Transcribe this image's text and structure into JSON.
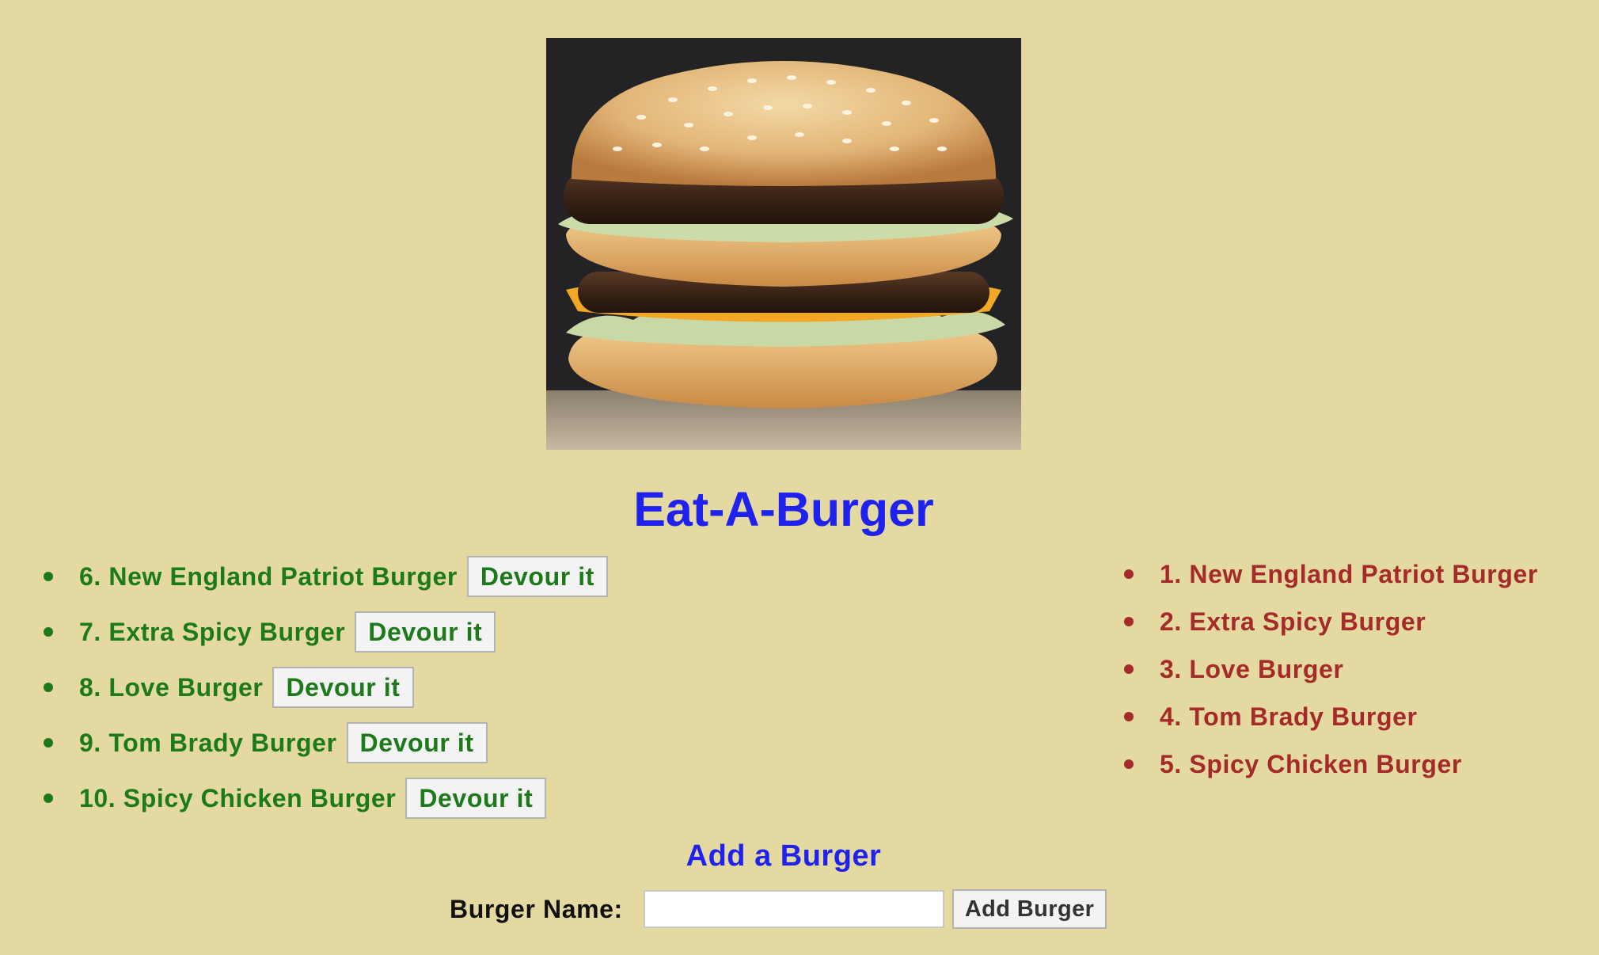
{
  "app": {
    "title": "Eat-A-Burger"
  },
  "hero": {
    "image_name": "burger-photo"
  },
  "uneaten": [
    {
      "label": "6. New England Patriot Burger",
      "button": "Devour it"
    },
    {
      "label": "7. Extra Spicy Burger",
      "button": "Devour it"
    },
    {
      "label": "8. Love Burger",
      "button": "Devour it"
    },
    {
      "label": "9. Tom Brady Burger",
      "button": "Devour it"
    },
    {
      "label": "10. Spicy Chicken Burger",
      "button": "Devour it"
    }
  ],
  "devoured": [
    {
      "label": "1. New England Patriot Burger"
    },
    {
      "label": "2. Extra Spicy Burger"
    },
    {
      "label": "3. Love Burger"
    },
    {
      "label": "4. Tom Brady Burger"
    },
    {
      "label": "5. Spicy Chicken Burger"
    }
  ],
  "form": {
    "heading": "Add a Burger",
    "label": "Burger Name:",
    "input_value": "",
    "input_placeholder": "",
    "submit_label": "Add Burger"
  },
  "colors": {
    "background": "#e4d9a0",
    "title": "#1f22ee",
    "uneaten": "#1d7a1b",
    "devoured": "#a52a2a"
  }
}
